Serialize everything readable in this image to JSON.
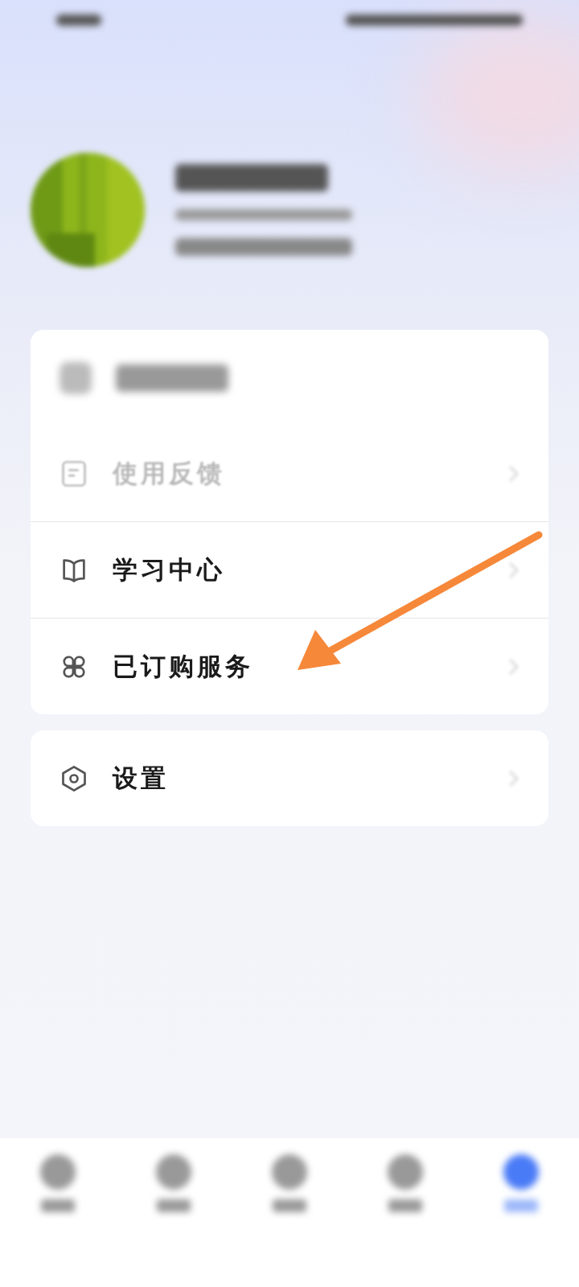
{
  "menu_groups": [
    {
      "rows": [
        {
          "kind": "blurred",
          "divider": false
        },
        {
          "kind": "faded",
          "label": "使用反馈",
          "divider": true
        },
        {
          "kind": "normal",
          "label": "学习中心",
          "divider": true
        },
        {
          "kind": "normal",
          "label": "已订购服务",
          "divider": false
        }
      ]
    },
    {
      "rows": [
        {
          "kind": "normal",
          "label": "设置",
          "divider": false
        }
      ]
    }
  ],
  "bottom_nav": [
    {
      "selected": false
    },
    {
      "selected": false
    },
    {
      "selected": false
    },
    {
      "selected": false
    },
    {
      "selected": true
    }
  ]
}
